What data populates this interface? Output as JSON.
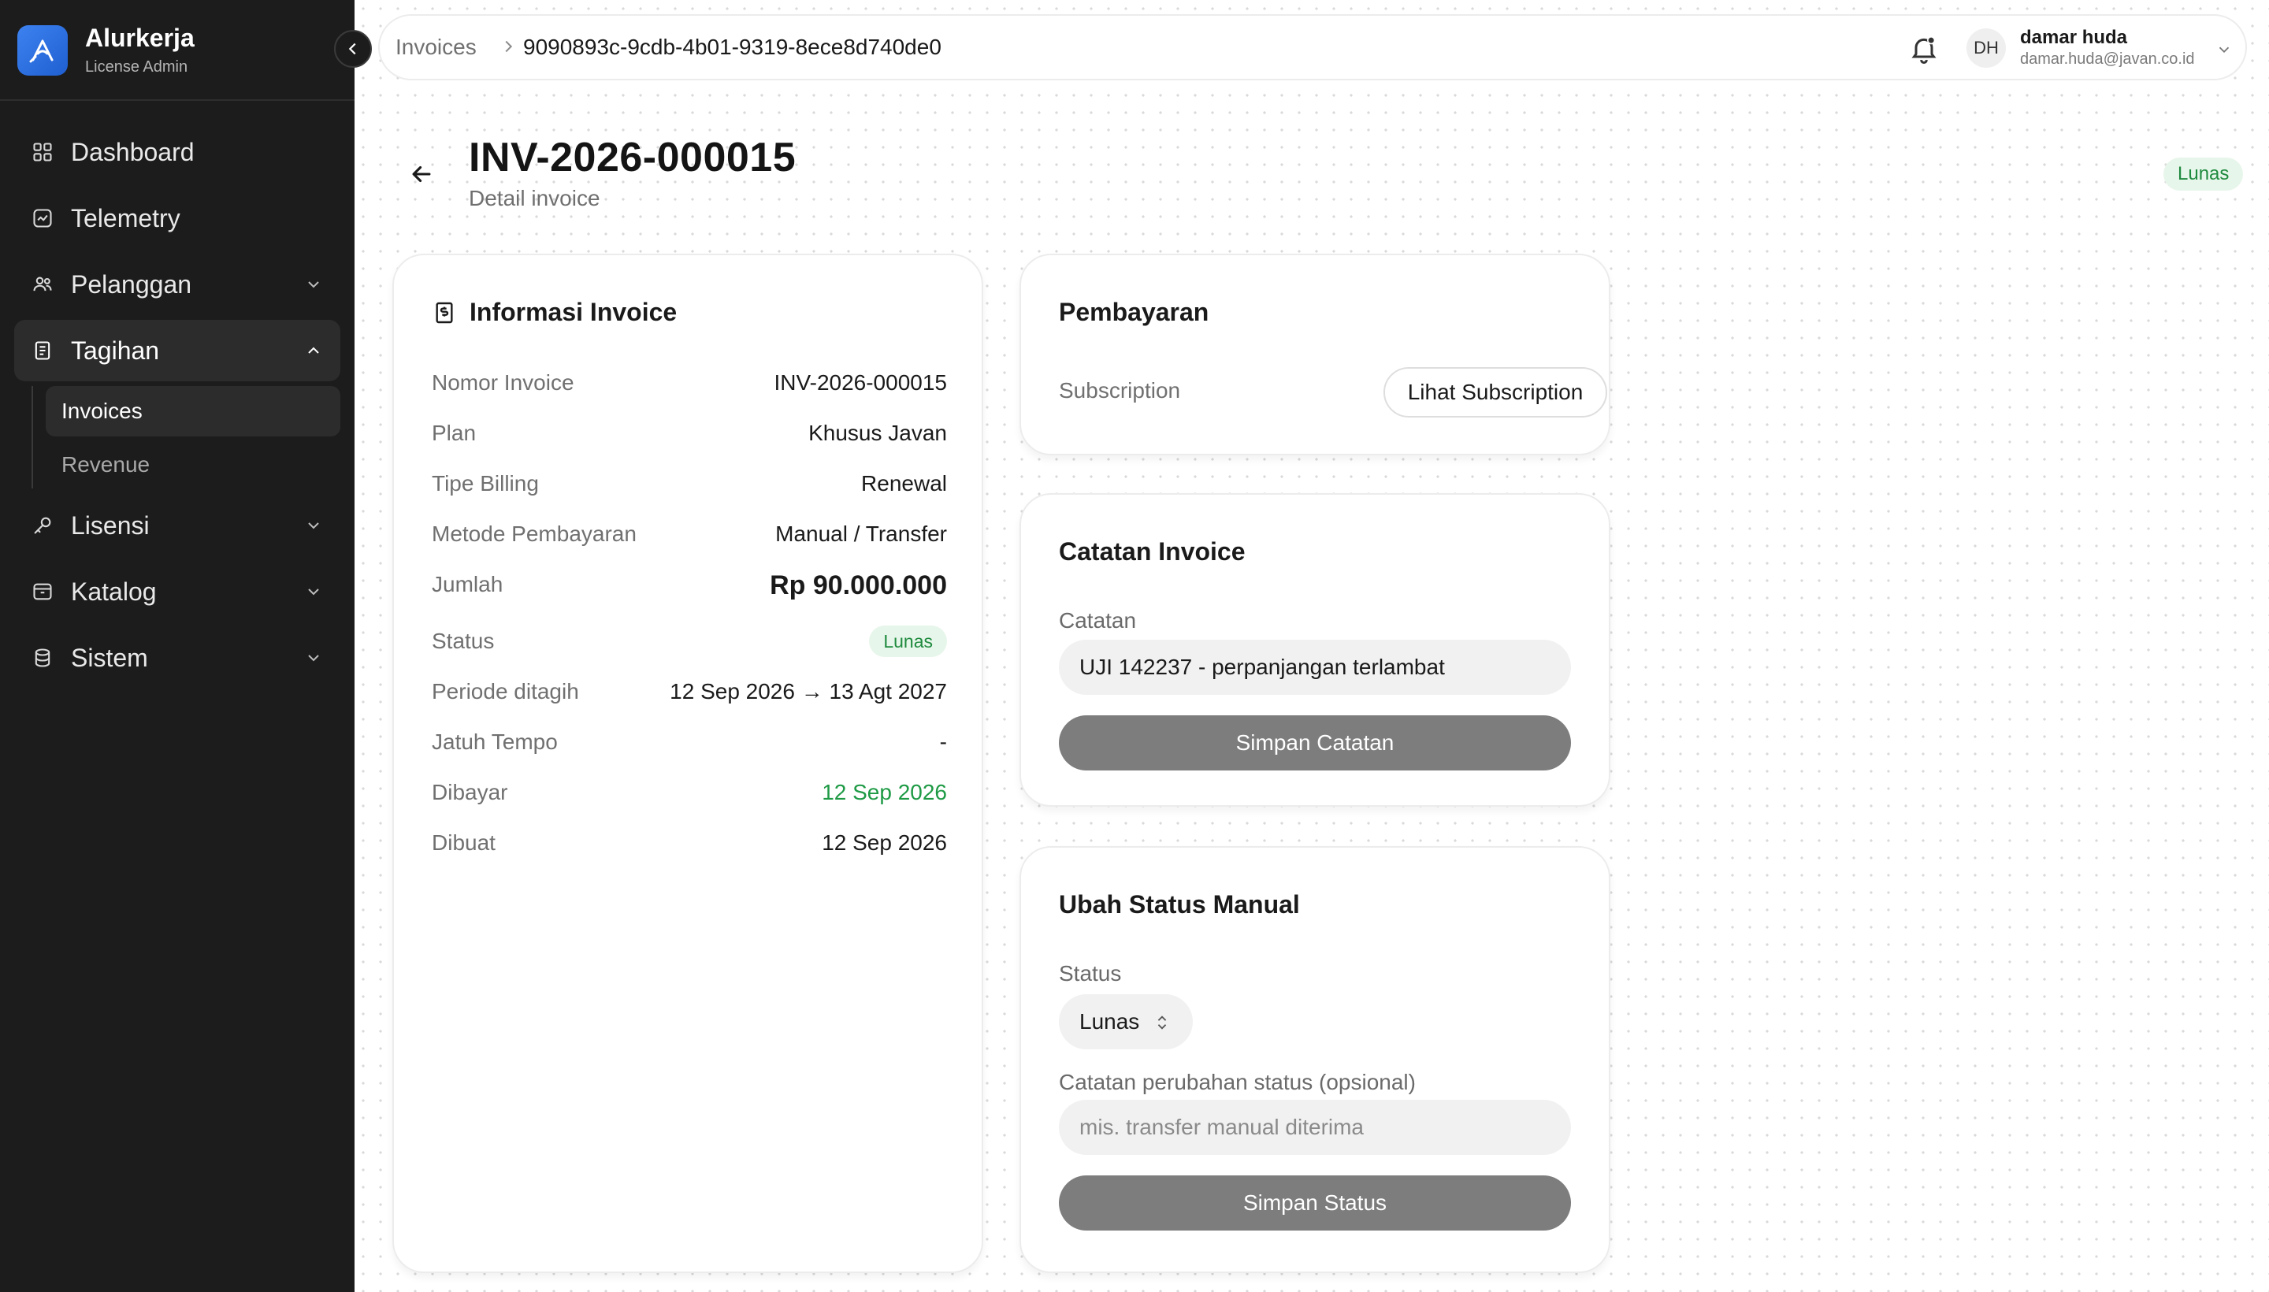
{
  "app": {
    "name": "Alurkerja",
    "subtitle": "License Admin"
  },
  "sidebar": {
    "items": [
      {
        "label": "Dashboard",
        "icon": "grid-icon"
      },
      {
        "label": "Telemetry",
        "icon": "activity-icon"
      },
      {
        "label": "Pelanggan",
        "icon": "users-icon"
      },
      {
        "label": "Tagihan",
        "icon": "receipt-icon"
      },
      {
        "label": "Lisensi",
        "icon": "key-icon"
      },
      {
        "label": "Katalog",
        "icon": "package-icon"
      },
      {
        "label": "Sistem",
        "icon": "database-icon"
      }
    ],
    "subitems": [
      {
        "label": "Invoices"
      },
      {
        "label": "Revenue"
      }
    ]
  },
  "breadcrumb": {
    "parent": "Invoices",
    "current": "9090893c-9cdb-4b01-9319-8ece8d740de0"
  },
  "user": {
    "initials": "DH",
    "name": "damar huda",
    "email": "damar.huda@javan.co.id"
  },
  "page": {
    "title": "INV-2026-000015",
    "subtitle": "Detail invoice",
    "status_badge": "Lunas"
  },
  "info": {
    "title": "Informasi Invoice",
    "rows": [
      {
        "key": "Nomor Invoice",
        "value": "INV-2026-000015"
      },
      {
        "key": "Plan",
        "value": "Khusus Javan"
      },
      {
        "key": "Tipe Billing",
        "value": "Renewal"
      },
      {
        "key": "Metode Pembayaran",
        "value": "Manual / Transfer"
      },
      {
        "key": "Jumlah",
        "value": "Rp 90.000.000"
      },
      {
        "key": "Status",
        "value": "Lunas"
      },
      {
        "key": "Periode ditagih",
        "value": "12 Sep 2026 → 13 Agt 2027"
      },
      {
        "key": "Jatuh Tempo",
        "value": "-"
      },
      {
        "key": "Dibayar",
        "value": "12 Sep 2026"
      },
      {
        "key": "Dibuat",
        "value": "12 Sep 2026"
      }
    ]
  },
  "payment": {
    "title": "Pembayaran",
    "subscription_label": "Subscription",
    "subscription_button": "Lihat Subscription"
  },
  "notes": {
    "title": "Catatan Invoice",
    "label": "Catatan",
    "value": "UJI 142237 - perpanjangan terlambat",
    "save_button": "Simpan Catatan"
  },
  "status_form": {
    "title": "Ubah Status Manual",
    "status_label": "Status",
    "status_value": "Lunas",
    "note_label": "Catatan perubahan status (opsional)",
    "note_placeholder": "mis. transfer manual diterima",
    "save_button": "Simpan Status"
  },
  "colors": {
    "sidebar": "#1c1c1c",
    "accent_blue": "#2f6fe0",
    "success": "#1e9a45",
    "success_bg": "#e7f6ea",
    "button_gray": "#7d7d7d"
  }
}
